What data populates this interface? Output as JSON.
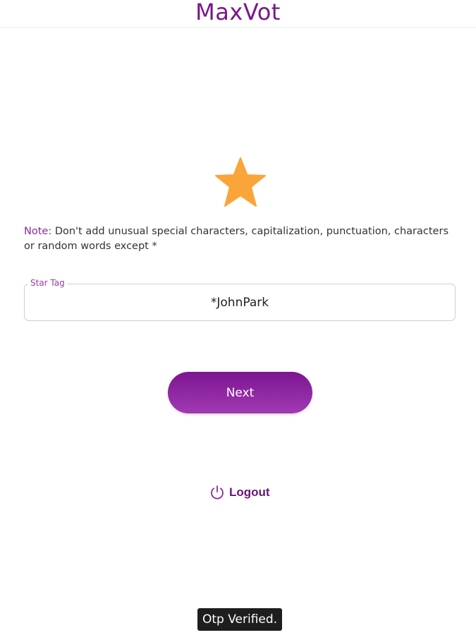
{
  "header": {
    "title": "MaxVot",
    "title_color": "#7b168c"
  },
  "hero": {
    "icon": "star-icon",
    "icon_color": "#f9a53a"
  },
  "note": {
    "label": "Note:",
    "text": " Don't add unusual special characters, capitalization, punctuation, characters or random words except *"
  },
  "star_tag": {
    "label": "Star Tag",
    "value": "*JohnPark"
  },
  "actions": {
    "next_label": "Next",
    "logout_label": "Logout",
    "logout_icon": "power-icon",
    "accent_color": "#8b2a9c"
  },
  "toast": {
    "message": "Otp Verified."
  }
}
